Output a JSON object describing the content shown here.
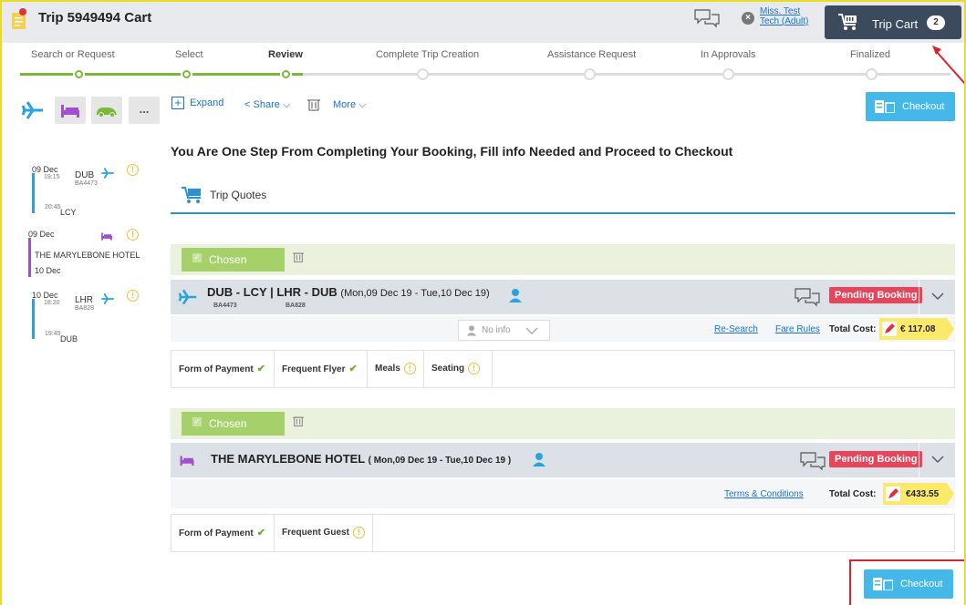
{
  "header": {
    "title": "Trip 5949494 Cart",
    "traveler_line1": "Miss. Test",
    "traveler_line2": "Tech (Adult)",
    "trip_cart_label": "Trip Cart",
    "trip_cart_count": "2"
  },
  "steps": [
    {
      "label": "Search or Request",
      "done": true
    },
    {
      "label": "Select",
      "done": true
    },
    {
      "label": "Review",
      "done": true,
      "current": true
    },
    {
      "label": "Complete Trip Creation",
      "done": false
    },
    {
      "label": "Assistance Request",
      "done": false
    },
    {
      "label": "In Approvals",
      "done": false
    },
    {
      "label": "Finalized",
      "done": false
    }
  ],
  "categories": [
    "flight-icon",
    "hotel-icon",
    "car-icon",
    "more-icon"
  ],
  "categories_more": "...",
  "itinerary": {
    "flight1": {
      "date": "09 Dec",
      "dep_time": "19:15",
      "from": "DUB",
      "code": "BA4473",
      "arr_time": "20:45",
      "to": "LCY"
    },
    "hotel": {
      "date_in": "09 Dec",
      "name": "THE MARYLEBONE HOTEL",
      "date_out": "10 Dec"
    },
    "flight2": {
      "date": "10 Dec",
      "dep_time": "18:20",
      "from": "LHR",
      "code": "BA828",
      "arr_time": "19:45",
      "to": "DUB"
    }
  },
  "toolbar": {
    "expand": "Expand",
    "share": "Share",
    "more": "More"
  },
  "checkout_label": "Checkout",
  "headline": "You Are One Step From Completing Your Booking, Fill info Needed and Proceed to Checkout",
  "quotes_tab": "Trip Quotes",
  "chosen_label": "Chosen",
  "flight_item": {
    "title": "DUB - LCY | LHR - DUB",
    "dates": "(Mon,09 Dec 19 - Tue,10 Dec 19)",
    "code1": "BA4473",
    "code2": "BA828",
    "status": "Pending Booking",
    "no_info": "No info",
    "research": "Re-Search",
    "fare_rules": "Fare Rules",
    "total_label": "Total Cost:",
    "total": "€ 117.08",
    "requirements": [
      {
        "label": "Form of Payment",
        "state": "ok"
      },
      {
        "label": "Frequent Flyer",
        "state": "ok"
      },
      {
        "label": "Meals",
        "state": "warn"
      },
      {
        "label": "Seating",
        "state": "warn"
      }
    ]
  },
  "hotel_item": {
    "title": "THE MARYLEBONE HOTEL",
    "dates": "( Mon,09 Dec 19 - Tue,10 Dec 19 )",
    "status": "Pending Booking",
    "terms": "Terms & Conditions",
    "total_label": "Total Cost:",
    "total": "€433.55",
    "requirements": [
      {
        "label": "Form of Payment",
        "state": "ok"
      },
      {
        "label": "Frequent Guest",
        "state": "warn"
      }
    ]
  },
  "colors": {
    "accent": "#45b8ea",
    "pending": "#e8445a",
    "chosen": "#a6d16a",
    "flight": "#29a3e0",
    "hotel": "#a04fd0",
    "car": "#7ab83a",
    "warn": "#f0c136"
  }
}
